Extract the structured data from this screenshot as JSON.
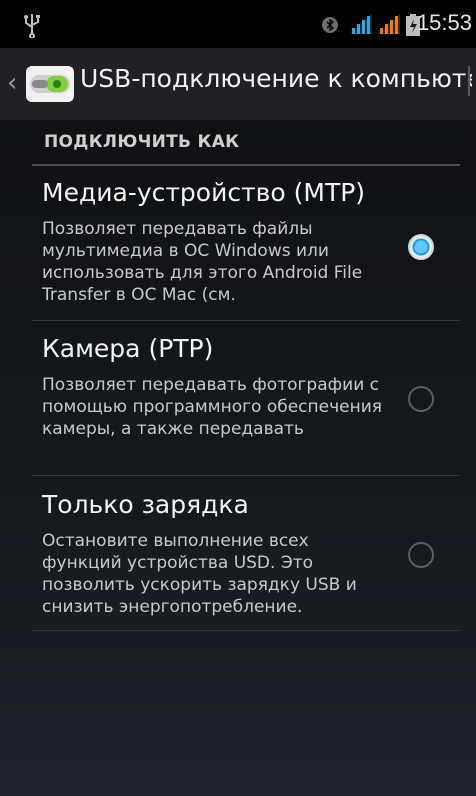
{
  "status_bar": {
    "time": "15:53",
    "icons": [
      "usb-icon",
      "bluetooth-icon",
      "signal-icon",
      "signal-icon",
      "battery-icon"
    ]
  },
  "action_bar": {
    "title": "USB-подключение к компьюте",
    "icon": "usb-app-icon"
  },
  "section": {
    "header": "ПОДКЛЮЧИТЬ КАК"
  },
  "options": [
    {
      "title": "Медиа-устройство (MTP)",
      "description": "Позволяет передавать файлы мультимедиа в ОС Windows или использовать для этого Android File Transfer в ОС Mac (см.",
      "selected": true
    },
    {
      "title": "Камера (PTP)",
      "description": "Позволяет передавать фотографии с помощью программного обеспечения камеры, а также передавать",
      "selected": false
    },
    {
      "title": "Только зарядка",
      "description": "Остановите выполнение всех функций устройства USD. Это позволить ускорить зарядку USB и снизить энергопотребление.",
      "selected": false
    }
  ],
  "colors": {
    "accent": "#1e9be0",
    "background": "#0f1114"
  }
}
